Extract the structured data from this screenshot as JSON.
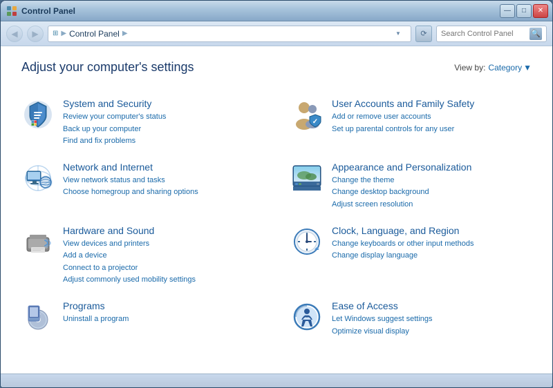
{
  "window": {
    "title": "Control Panel",
    "controls": {
      "minimize": "—",
      "maximize": "□",
      "close": "✕"
    }
  },
  "navbar": {
    "back_tooltip": "Back",
    "forward_tooltip": "Forward",
    "address": "Control Panel",
    "search_placeholder": "Search Control Panel",
    "refresh": "⟳",
    "dropdown_arrow": "▼",
    "nav_arrow": "▶"
  },
  "page": {
    "title": "Adjust your computer's settings",
    "view_by_label": "View by:",
    "view_by_value": "Category",
    "view_by_arrow": "▼"
  },
  "categories": [
    {
      "id": "system-security",
      "title": "System and Security",
      "links": [
        "Review your computer's status",
        "Back up your computer",
        "Find and fix problems"
      ]
    },
    {
      "id": "user-accounts",
      "title": "User Accounts and Family Safety",
      "links": [
        "Add or remove user accounts",
        "Set up parental controls for any user"
      ]
    },
    {
      "id": "network-internet",
      "title": "Network and Internet",
      "links": [
        "View network status and tasks",
        "Choose homegroup and sharing options"
      ]
    },
    {
      "id": "appearance",
      "title": "Appearance and Personalization",
      "links": [
        "Change the theme",
        "Change desktop background",
        "Adjust screen resolution"
      ]
    },
    {
      "id": "hardware-sound",
      "title": "Hardware and Sound",
      "links": [
        "View devices and printers",
        "Add a device",
        "Connect to a projector",
        "Adjust commonly used mobility settings"
      ]
    },
    {
      "id": "clock-language",
      "title": "Clock, Language, and Region",
      "links": [
        "Change keyboards or other input methods",
        "Change display language"
      ]
    },
    {
      "id": "programs",
      "title": "Programs",
      "links": [
        "Uninstall a program"
      ]
    },
    {
      "id": "ease-access",
      "title": "Ease of Access",
      "links": [
        "Let Windows suggest settings",
        "Optimize visual display"
      ]
    }
  ]
}
